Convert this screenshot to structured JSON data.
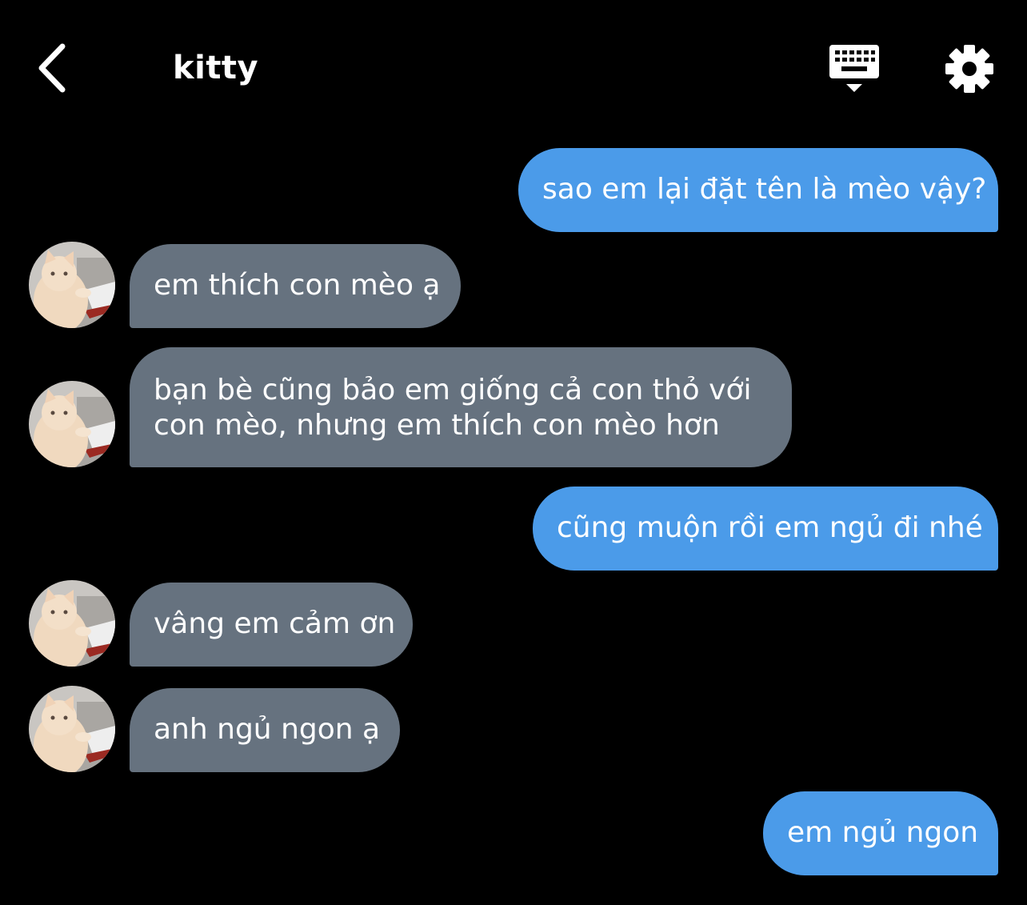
{
  "header": {
    "contact_name": "kitty",
    "back_icon": "chevron-left-icon",
    "keyboard_icon": "keyboard-icon",
    "settings_icon": "gear-icon"
  },
  "colors": {
    "background": "#000000",
    "outgoing_bubble": "#4b9be9",
    "incoming_bubble": "#66727f",
    "text": "#ffffff"
  },
  "messages": [
    {
      "direction": "outgoing",
      "text": "sao em lại đặt tên là mèo vậy?"
    },
    {
      "direction": "incoming",
      "text": "em thích con mèo ạ"
    },
    {
      "direction": "incoming",
      "line1": "bạn bè cũng bảo em giống cả con thỏ với",
      "line2": "con mèo, nhưng em thích con mèo hơn"
    },
    {
      "direction": "outgoing",
      "text": "cũng muộn rồi em ngủ đi nhé"
    },
    {
      "direction": "incoming",
      "text": "vâng em cảm ơn"
    },
    {
      "direction": "incoming",
      "text": "anh ngủ ngon ạ"
    },
    {
      "direction": "outgoing",
      "text": "em ngủ ngon"
    }
  ]
}
